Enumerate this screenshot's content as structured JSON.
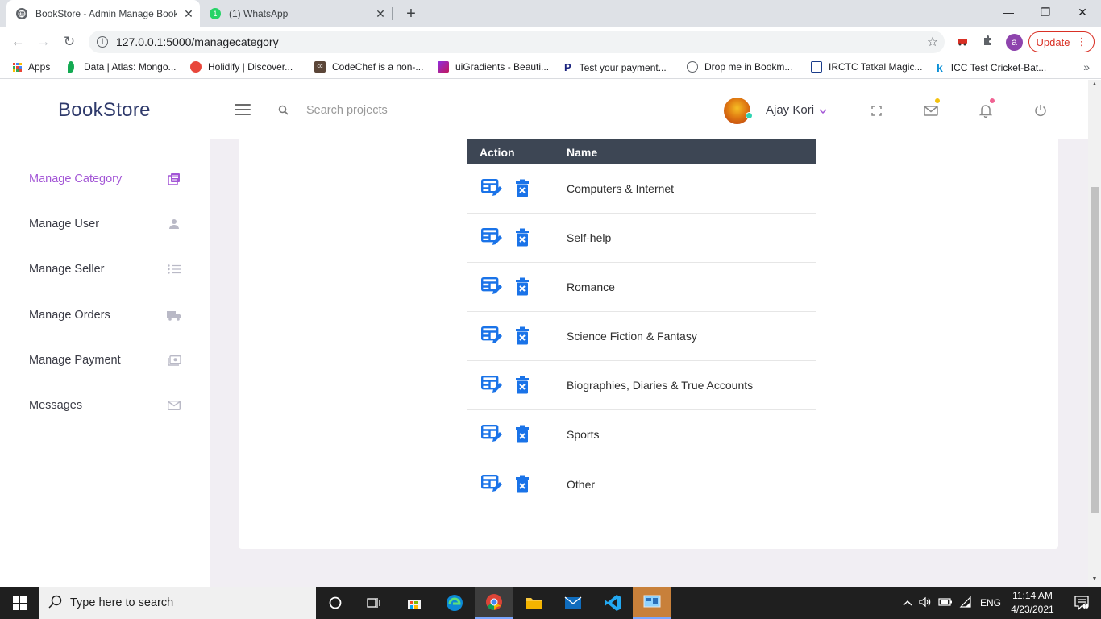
{
  "browser": {
    "tabs": [
      {
        "title": "BookStore - Admin Manage Book",
        "active": true
      },
      {
        "title": "(1) WhatsApp",
        "active": false,
        "badge": "1"
      }
    ],
    "url": "127.0.0.1:5000/managecategory",
    "profile_initial": "a",
    "update_label": "Update",
    "bookmarks": [
      {
        "label": "Apps"
      },
      {
        "label": "Data | Atlas: Mongo..."
      },
      {
        "label": "Holidify | Discover..."
      },
      {
        "label": "CodeChef is a non-..."
      },
      {
        "label": "uiGradients - Beauti..."
      },
      {
        "label": "Test your payment..."
      },
      {
        "label": "Drop me in Bookm..."
      },
      {
        "label": "IRCTC Tatkal Magic..."
      },
      {
        "label": "ICC Test Cricket-Bat..."
      }
    ]
  },
  "app": {
    "brand": "BookStore",
    "search_placeholder": "Search projects",
    "user_name": "Ajay Kori"
  },
  "sidebar": {
    "items": [
      {
        "label": "Manage Category",
        "icon": "book-icon",
        "active": true
      },
      {
        "label": "Manage User",
        "icon": "user-icon",
        "active": false
      },
      {
        "label": "Manage Seller",
        "icon": "list-icon",
        "active": false
      },
      {
        "label": "Manage Orders",
        "icon": "truck-icon",
        "active": false
      },
      {
        "label": "Manage Payment",
        "icon": "payment-icon",
        "active": false
      },
      {
        "label": "Messages",
        "icon": "mail-icon",
        "active": false
      }
    ]
  },
  "table": {
    "headers": [
      "Action",
      "Name"
    ],
    "rows": [
      {
        "name": "Computers & Internet"
      },
      {
        "name": "Self-help"
      },
      {
        "name": "Romance"
      },
      {
        "name": "Science Fiction & Fantasy"
      },
      {
        "name": "Biographies, Diaries & True Accounts"
      },
      {
        "name": "Sports"
      },
      {
        "name": "Other"
      }
    ]
  },
  "taskbar": {
    "search_placeholder": "Type here to search",
    "language": "ENG",
    "time": "11:14 AM",
    "date": "4/23/2021"
  },
  "colors": {
    "accent": "#a356d6",
    "table_header": "#3d4654",
    "action_icon": "#1a73e8",
    "brand": "#2f3a6b"
  }
}
